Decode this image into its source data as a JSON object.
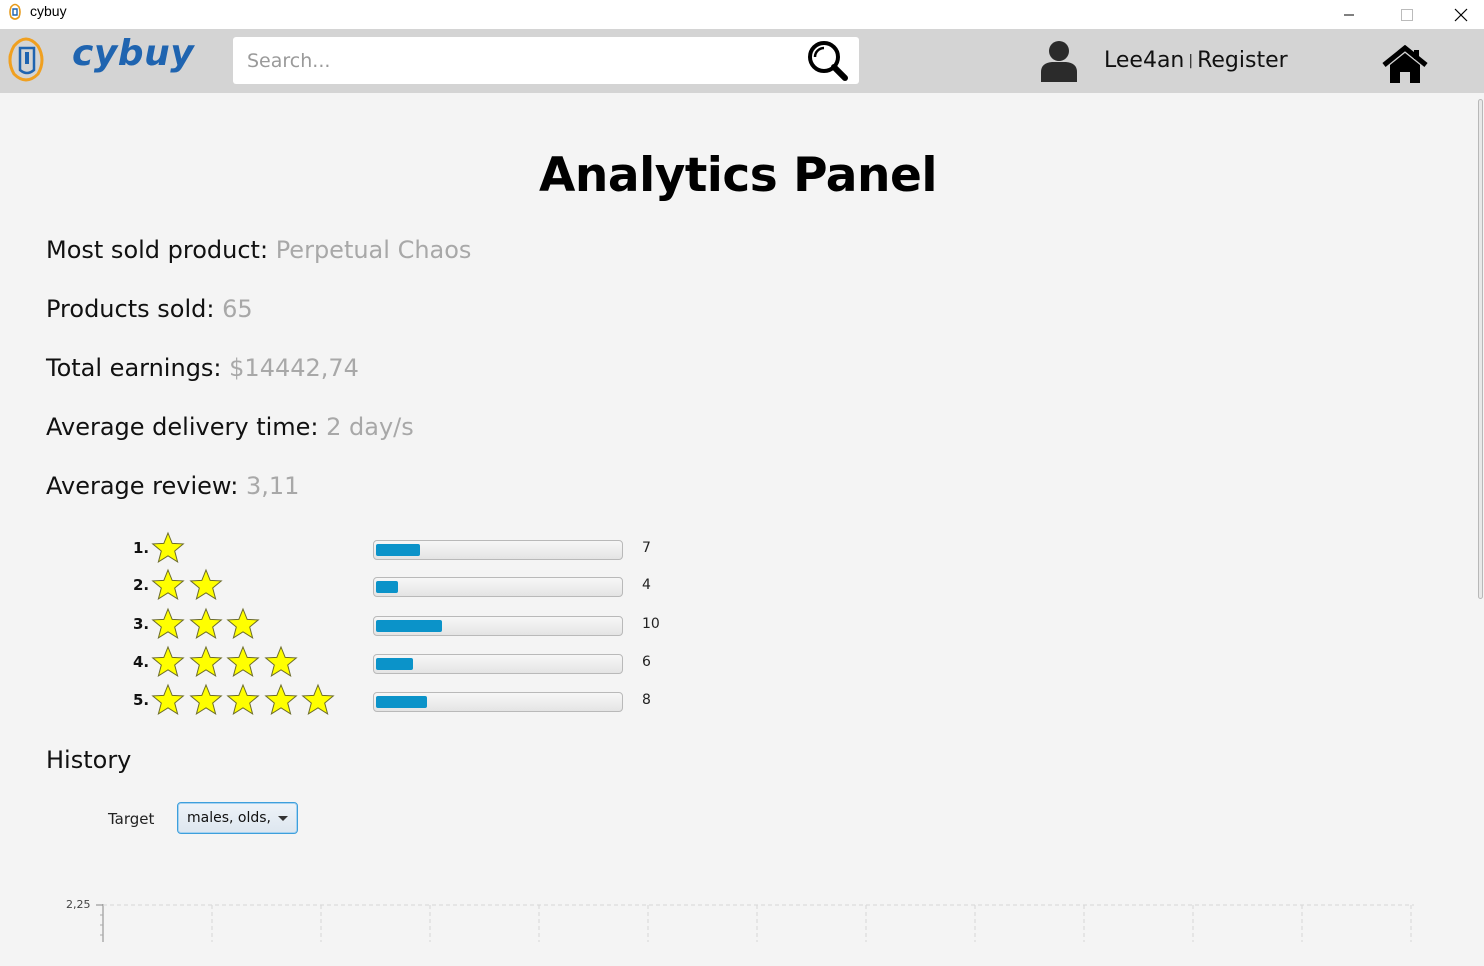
{
  "window": {
    "title": "cybuy"
  },
  "header": {
    "logo_text": "cybuy",
    "search_placeholder": "Search...",
    "user_name": "Lee4an",
    "separator": "|",
    "register_label": "Register"
  },
  "page": {
    "title": "Analytics Panel"
  },
  "stats": [
    {
      "label": "Most sold product:",
      "value": "Perpetual Chaos"
    },
    {
      "label": "Products sold:",
      "value": "65"
    },
    {
      "label": "Total earnings:",
      "value": "$14442,74"
    },
    {
      "label": "Average delivery time:",
      "value": "2 day/s"
    },
    {
      "label": "Average review:",
      "value": "3,11"
    }
  ],
  "reviews": [
    {
      "num": "1.",
      "stars": 1,
      "count": "7",
      "fraction": 0.18
    },
    {
      "num": "2.",
      "stars": 2,
      "count": "4",
      "fraction": 0.09
    },
    {
      "num": "3.",
      "stars": 3,
      "count": "10",
      "fraction": 0.27
    },
    {
      "num": "4.",
      "stars": 4,
      "count": "6",
      "fraction": 0.15
    },
    {
      "num": "5.",
      "stars": 5,
      "count": "8",
      "fraction": 0.21
    }
  ],
  "history": {
    "title": "History",
    "target_label": "Target",
    "target_value": "males, olds,"
  },
  "chart_data": {
    "type": "line",
    "title": "",
    "xlabel": "",
    "ylabel": "",
    "y_tick_labels": [
      "2,25"
    ],
    "grid": true,
    "series": []
  },
  "colors": {
    "logo_blue": "#1f64b0",
    "bar_fill": "#0b93c9",
    "star_fill": "#ffff00",
    "value_gray": "#a8a8a8"
  }
}
